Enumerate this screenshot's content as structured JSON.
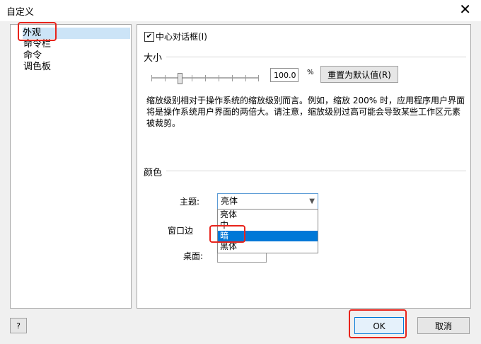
{
  "window": {
    "title": "自定义",
    "close_glyph": "✕"
  },
  "sidebar": {
    "items": [
      {
        "label": "外观",
        "selected": true
      },
      {
        "label": "命令栏"
      },
      {
        "label": "命令"
      },
      {
        "label": "调色板"
      }
    ]
  },
  "appearance": {
    "center_dialog_label": "中心对话框(I)",
    "center_dialog_checked": true,
    "size_section": "大小",
    "zoom_value": "100.0",
    "zoom_unit": "%",
    "slider_level_percent": 26,
    "reset_label": "重置为默认值(R)",
    "description": "缩放级别相对于操作系统的缩放级别而言。例如，缩放 200% 时，应用程序用户界面将是操作系统用户界面的两倍大。请注意，缩放级别过高可能会导致某些工作区元素被裁剪。",
    "color_section": "颜色",
    "theme_label": "主题:",
    "theme_value": "亮体",
    "theme_options": [
      "亮体",
      "中",
      "暗",
      "黑体"
    ],
    "theme_highlighted": "暗",
    "window_border_label": "窗口边",
    "desktop_label": "桌面:"
  },
  "footer": {
    "help_label": "?",
    "ok_label": "OK",
    "cancel_label": "取消"
  },
  "colors": {
    "highlight_red": "#e8231b",
    "selection_blue": "#0078d7"
  }
}
